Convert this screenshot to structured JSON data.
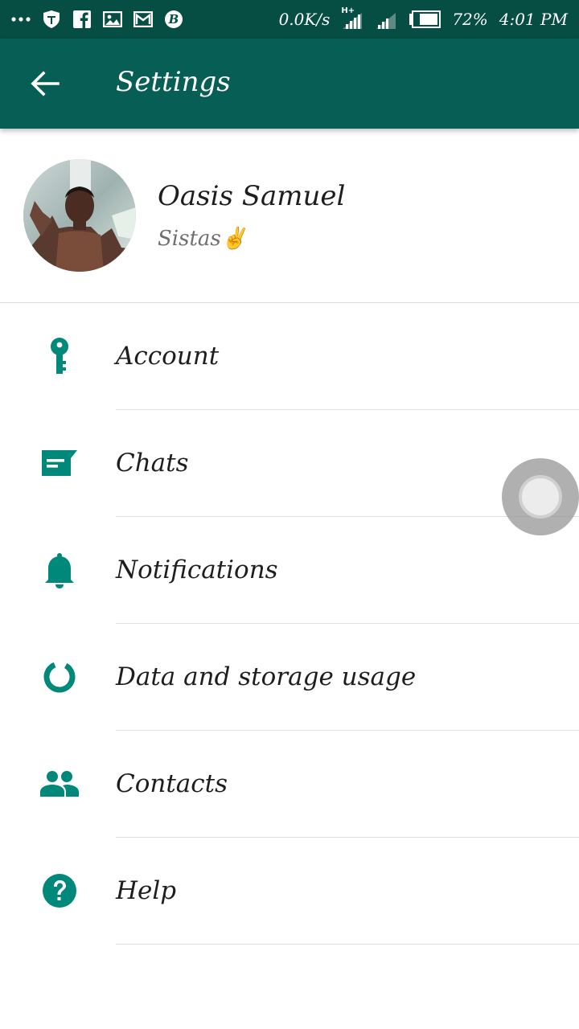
{
  "status_bar": {
    "network_speed": "0.0K/s",
    "network_type": "H+",
    "battery": "72%",
    "time": "4:01 PM",
    "icons": [
      "more-icon",
      "shield-icon",
      "facebook-icon",
      "gallery-icon",
      "gmail-icon",
      "b-app-icon",
      "signal-icon",
      "signal-icon-2",
      "battery-icon"
    ]
  },
  "app_bar": {
    "title": "Settings"
  },
  "profile": {
    "name": "Oasis Samuel",
    "status": "Sistas✌"
  },
  "menu": {
    "items": [
      {
        "label": "Account",
        "icon": "key-icon"
      },
      {
        "label": "Chats",
        "icon": "chat-icon"
      },
      {
        "label": "Notifications",
        "icon": "bell-icon"
      },
      {
        "label": "Data and storage usage",
        "icon": "data-usage-icon"
      },
      {
        "label": "Contacts",
        "icon": "contacts-icon"
      },
      {
        "label": "Help",
        "icon": "help-icon"
      }
    ]
  },
  "colors": {
    "status_bar": "#064d43",
    "app_bar": "#075e54",
    "accent": "#00897b"
  }
}
